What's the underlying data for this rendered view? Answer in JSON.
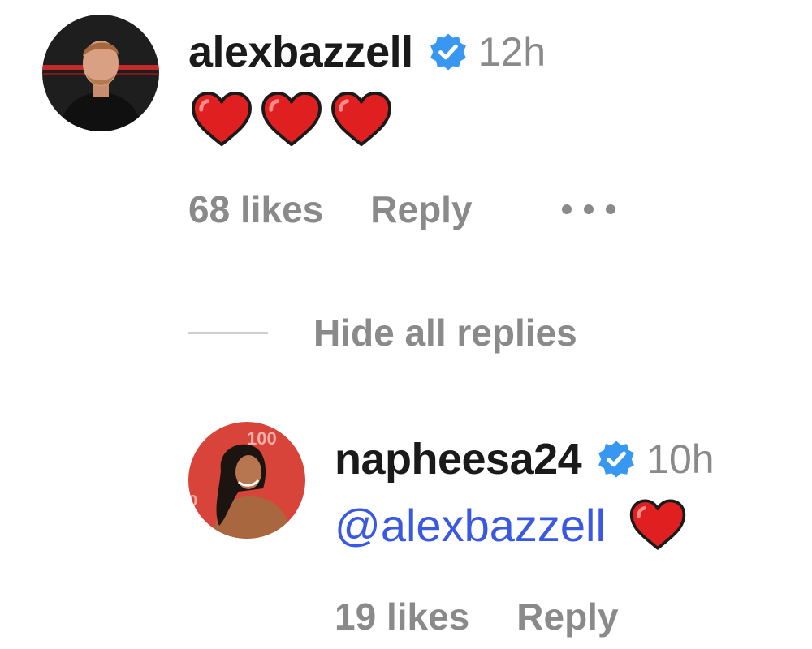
{
  "comment": {
    "username": "alexbazzell",
    "timestamp": "12h",
    "emoji_icons": [
      "heart-emoji",
      "heart-emoji",
      "heart-emoji"
    ],
    "likes": "68 likes",
    "reply_label": "Reply",
    "more_icon": "more-horizontal-icon"
  },
  "thread": {
    "hide_replies_label": "Hide all replies"
  },
  "reply": {
    "username": "napheesa24",
    "timestamp": "10h",
    "mention": "@alexbazzell",
    "emoji_icon": "heart-emoji",
    "likes": "19 likes",
    "reply_label": "Reply"
  },
  "colors": {
    "verified_blue": "#3897f0",
    "mention_blue": "#3a58e0",
    "heart_red": "#e02020",
    "muted_text": "#8a8a8a",
    "primary_text": "#1a1a1a"
  }
}
